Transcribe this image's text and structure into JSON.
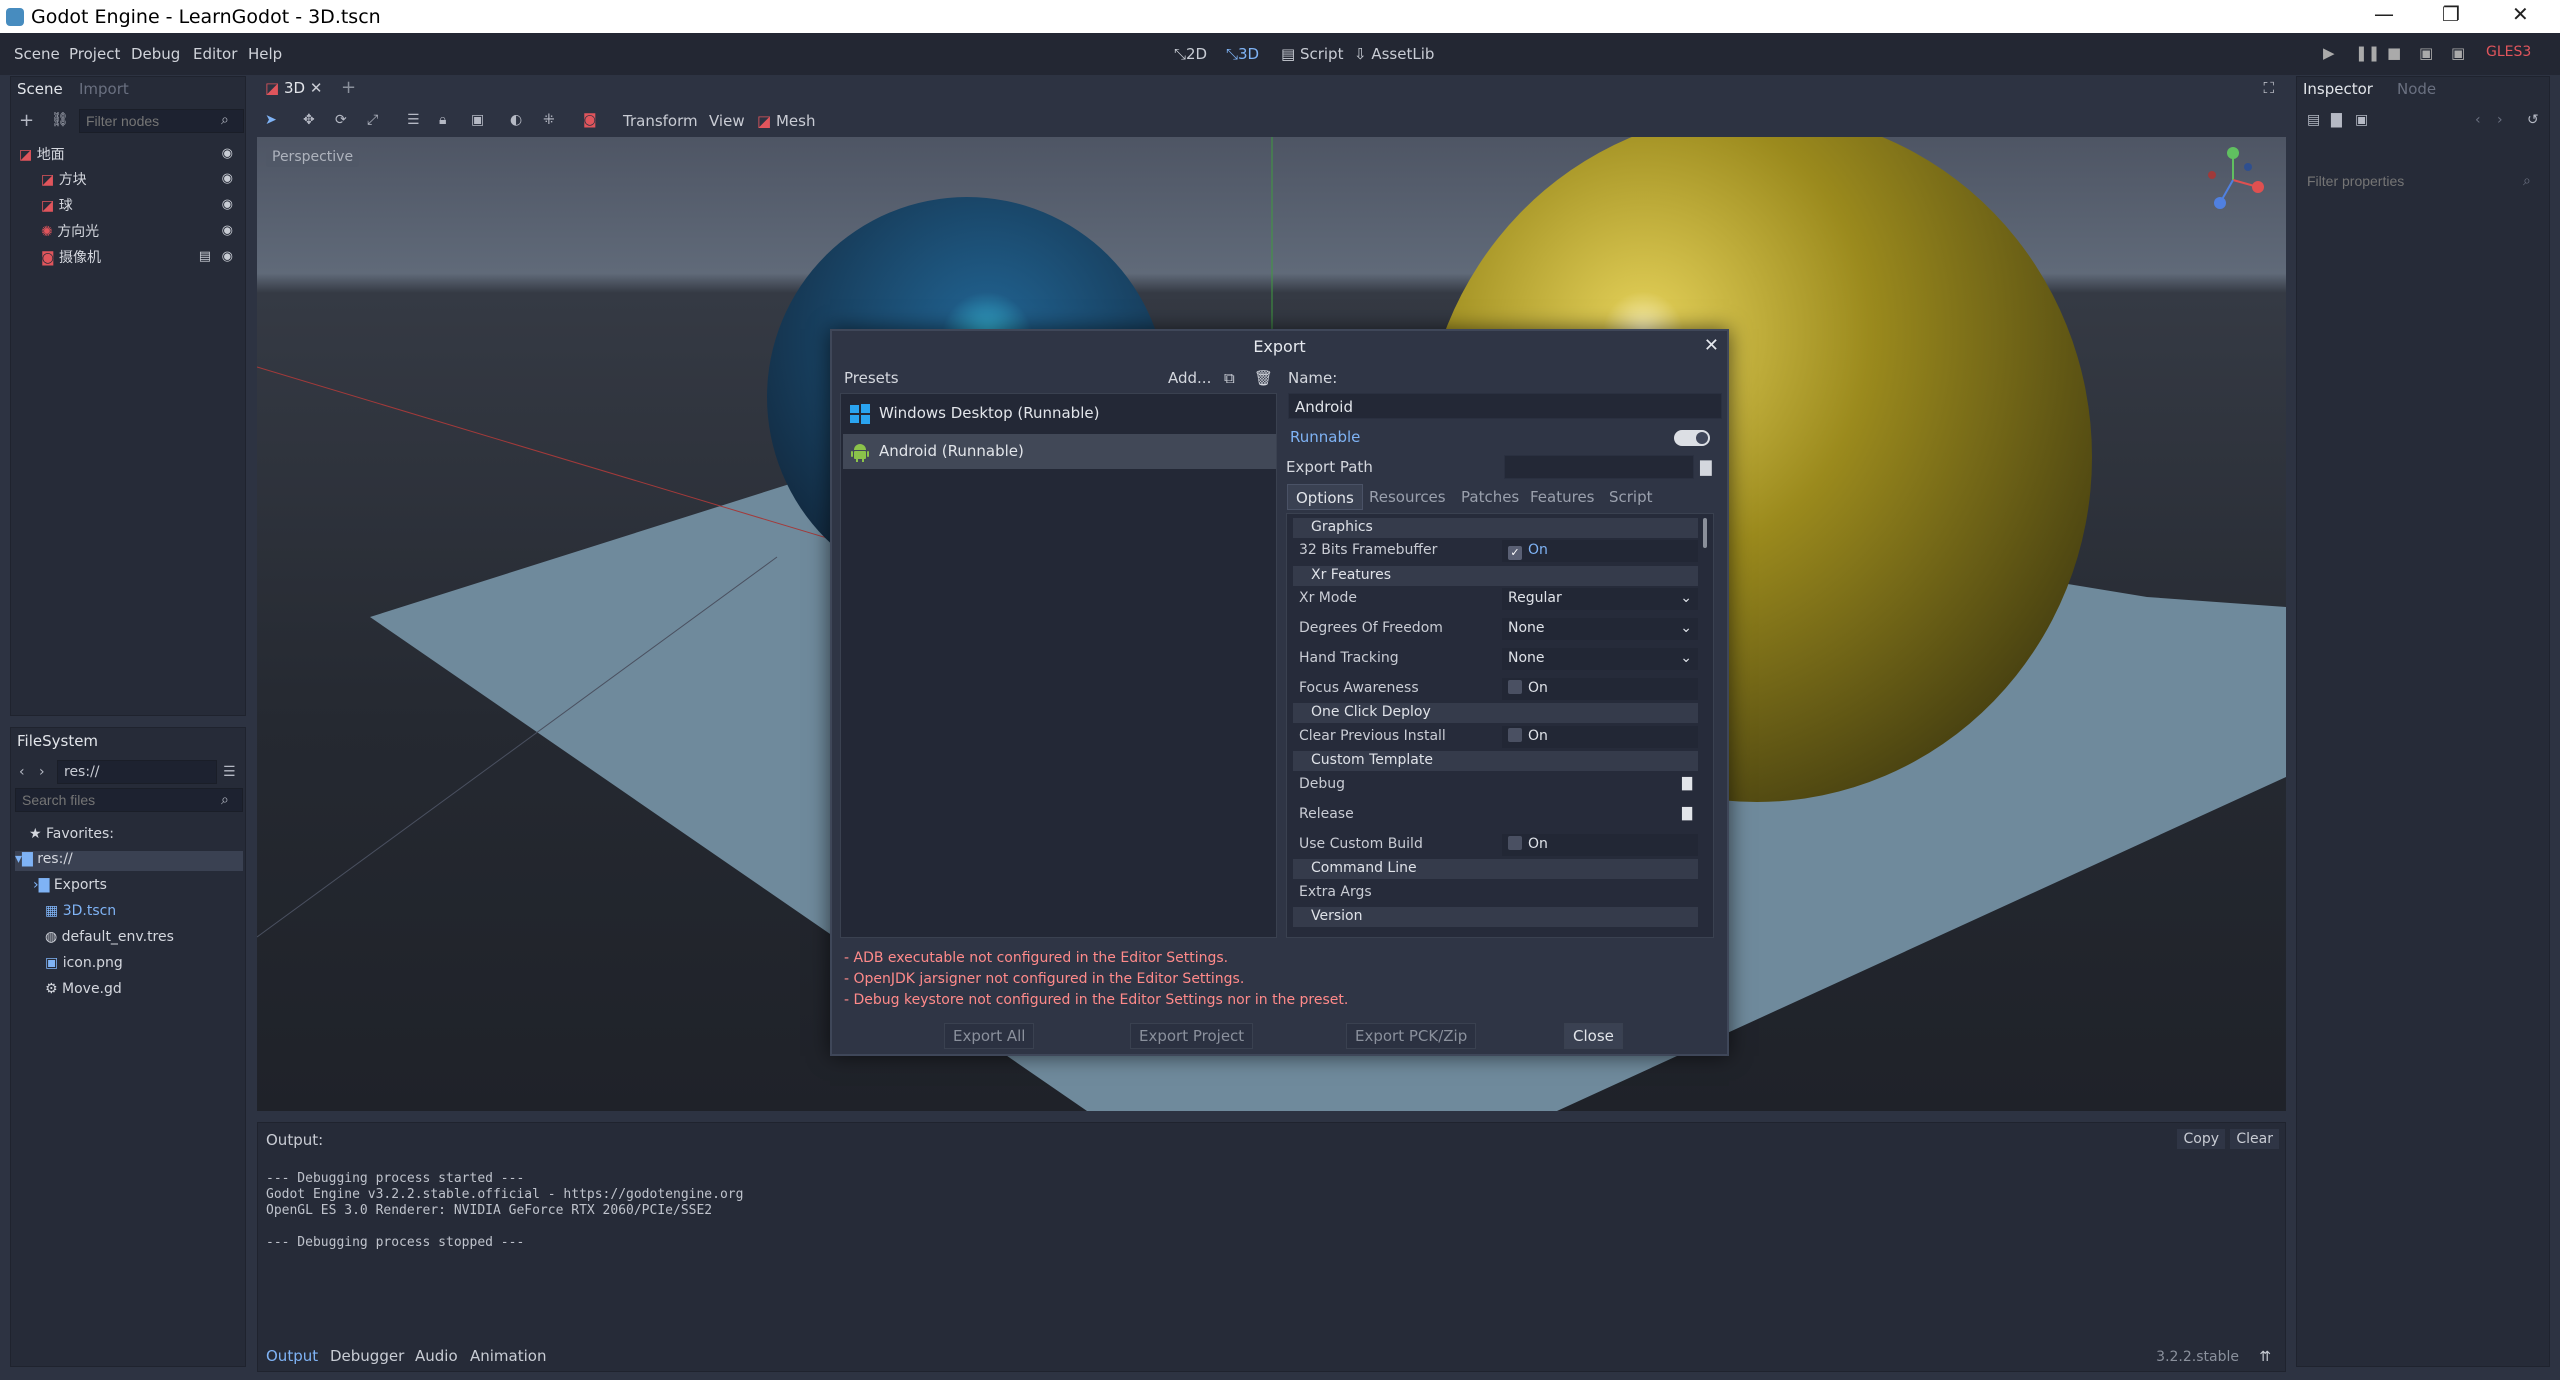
{
  "window": {
    "title": "Godot Engine - LearnGodot - 3D.tscn",
    "minimize": "—",
    "maximize": "❐",
    "close": "✕"
  },
  "menu": [
    "Scene",
    "Project",
    "Debug",
    "Editor",
    "Help"
  ],
  "workspaces": [
    {
      "label": "2D",
      "icon": "2d-icon"
    },
    {
      "label": "3D",
      "icon": "3d-icon",
      "active": true
    },
    {
      "label": "Script",
      "icon": "script-icon"
    },
    {
      "label": "AssetLib",
      "icon": "assetlib-icon"
    }
  ],
  "renderer": "GLES3",
  "scene_dock": {
    "tabs": [
      "Scene",
      "Import"
    ],
    "filter_placeholder": "Filter nodes",
    "nodes": [
      {
        "label": "地面",
        "indent": 0
      },
      {
        "label": "方块",
        "indent": 1
      },
      {
        "label": "球",
        "indent": 1
      },
      {
        "label": "方向光",
        "indent": 1
      },
      {
        "label": "摄像机",
        "indent": 1
      }
    ]
  },
  "filesystem_dock": {
    "title": "FileSystem",
    "path": "res://",
    "search_placeholder": "Search files",
    "items": [
      {
        "label": "Favorites:",
        "indent": 0
      },
      {
        "label": "res://",
        "indent": 0,
        "selected": true
      },
      {
        "label": "Exports",
        "indent": 1
      },
      {
        "label": "3D.tscn",
        "indent": 1,
        "accent": true
      },
      {
        "label": "default_env.tres",
        "indent": 1
      },
      {
        "label": "icon.png",
        "indent": 1
      },
      {
        "label": "Move.gd",
        "indent": 1
      }
    ]
  },
  "scene_tab": "3D",
  "viewport_toolbar": {
    "transform": "Transform",
    "view": "View",
    "mesh": "Mesh"
  },
  "viewport": {
    "perspective": "Perspective"
  },
  "inspector_dock": {
    "tabs": [
      "Inspector",
      "Node"
    ],
    "filter_placeholder": "Filter properties"
  },
  "output": {
    "label": "Output:",
    "copy": "Copy",
    "clear": "Clear",
    "lines": "--- Debugging process started ---\nGodot Engine v3.2.2.stable.official - https://godotengine.org\nOpenGL ES 3.0 Renderer: NVIDIA GeForce RTX 2060/PCIe/SSE2\n\n--- Debugging process stopped ---",
    "bottom_tabs": [
      "Output",
      "Debugger",
      "Audio",
      "Animation"
    ],
    "version": "3.2.2.stable"
  },
  "export_dialog": {
    "title": "Export",
    "presets_label": "Presets",
    "add_label": "Add...",
    "presets": [
      {
        "label": "Windows Desktop (Runnable)",
        "icon": "windows-icon"
      },
      {
        "label": "Android (Runnable)",
        "icon": "android-icon",
        "selected": true
      }
    ],
    "name_label": "Name:",
    "name_value": "Android",
    "runnable_label": "Runnable",
    "runnable_on": true,
    "export_path_label": "Export Path",
    "tabs": [
      "Options",
      "Resources",
      "Patches",
      "Features",
      "Script"
    ],
    "options": {
      "graphics": "Graphics",
      "fb32_label": "32 Bits Framebuffer",
      "on": "On",
      "xr_features": "Xr Features",
      "xr_mode_label": "Xr Mode",
      "xr_mode_value": "Regular",
      "dof_label": "Degrees Of Freedom",
      "dof_value": "None",
      "hand_label": "Hand Tracking",
      "hand_value": "None",
      "focus_label": "Focus Awareness",
      "one_click": "One Click Deploy",
      "clear_prev_label": "Clear Previous Install",
      "custom_template": "Custom Template",
      "debug_label": "Debug",
      "release_label": "Release",
      "use_custom_build_label": "Use Custom Build",
      "command_line": "Command Line",
      "extra_args_label": "Extra Args",
      "version": "Version"
    },
    "errors": [
      "- ADB executable not configured in the Editor Settings.",
      "- OpenJDK jarsigner not configured in the Editor Settings.",
      "- Debug keystore not configured in the Editor Settings nor in the preset."
    ],
    "buttons": {
      "export_all": "Export All",
      "export_project": "Export Project",
      "export_pck": "Export PCK/Zip",
      "close": "Close"
    }
  }
}
